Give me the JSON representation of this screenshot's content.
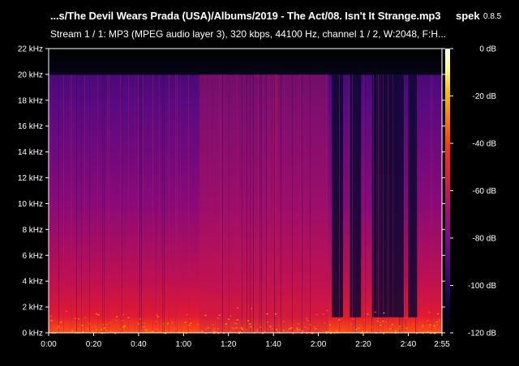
{
  "header": {
    "file_title": "...s/The Devil Wears Prada (USA)/Albums/2019 - The Act/08. Isn't It Strange.mp3",
    "app_name": "spek",
    "app_version": "0.8.5",
    "stream_info": "Stream 1 / 1: MP3 (MPEG audio layer 3), 320 kbps, 44100 Hz, channel 1 / 2, W:2048, F:H..."
  },
  "colors": {
    "background": "#000000",
    "axis": "#ffffff",
    "palette": [
      "#000000",
      "#0a0a3a",
      "#3a0a6a",
      "#7a0a8a",
      "#b0106a",
      "#e0203a",
      "#ff3010",
      "#ff7a00",
      "#ffc000",
      "#ffff80",
      "#ffffff"
    ]
  },
  "chart_data": {
    "type": "heatmap",
    "title": "",
    "x_ticks": [
      "0:00",
      "0:20",
      "0:40",
      "1:00",
      "1:20",
      "1:40",
      "2:00",
      "2:20",
      "2:40",
      "2:55"
    ],
    "x_tick_seconds": [
      0,
      20,
      40,
      60,
      80,
      100,
      120,
      140,
      160,
      175
    ],
    "xlim_seconds": [
      0,
      175
    ],
    "y_ticks": [
      "0 kHz",
      "2 kHz",
      "4 kHz",
      "6 kHz",
      "8 kHz",
      "10 kHz",
      "12 kHz",
      "14 kHz",
      "16 kHz",
      "18 kHz",
      "20 kHz",
      "22 kHz"
    ],
    "y_tick_khz": [
      0,
      2,
      4,
      6,
      8,
      10,
      12,
      14,
      16,
      18,
      20,
      22
    ],
    "ylim_khz": [
      0,
      22
    ],
    "colorbar_ticks": [
      "0 dB",
      "-20 dB",
      "-40 dB",
      "-60 dB",
      "-80 dB",
      "-100 dB",
      "-120 dB"
    ],
    "colorbar_db": [
      0,
      -20,
      -40,
      -60,
      -80,
      -100,
      -120
    ],
    "colorbar_range_db": [
      -120,
      0
    ],
    "lowpass_cutoff_khz": 20,
    "quiet_sections_seconds": [
      [
        126,
        131
      ],
      [
        134,
        139
      ],
      [
        144,
        158
      ],
      [
        160,
        164
      ]
    ],
    "denser_sections_seconds": [
      [
        67,
        102
      ],
      [
        100,
        124
      ]
    ]
  }
}
